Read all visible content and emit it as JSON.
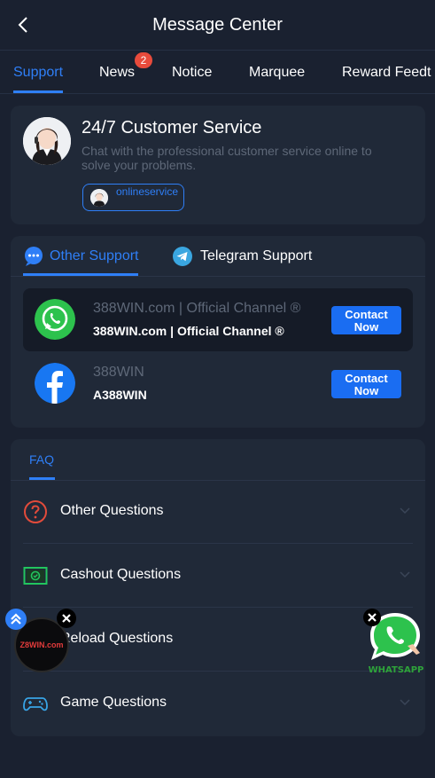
{
  "header": {
    "title": "Message Center"
  },
  "tabs": [
    {
      "label": "Support",
      "active": true
    },
    {
      "label": "News",
      "badge": "2"
    },
    {
      "label": "Notice"
    },
    {
      "label": "Marquee"
    },
    {
      "label": "Reward Feedt"
    }
  ],
  "customer_service": {
    "title": "24/7 Customer Service",
    "description": "Chat with the professional customer service online to solve your problems.",
    "online_label": "onlineservice"
  },
  "support": {
    "tabs": [
      {
        "label": "Other Support",
        "active": true
      },
      {
        "label": "Telegram Support"
      }
    ],
    "contacts": [
      {
        "title": "388WIN.com | Official Channel ®",
        "name": "388WIN.com | Official Channel ®",
        "button": "Contact Now",
        "icon": "whatsapp-icon"
      },
      {
        "title": "388WIN",
        "name": "A388WIN",
        "button": "Contact Now",
        "icon": "facebook-icon"
      }
    ]
  },
  "faq": {
    "tab_label": "FAQ",
    "items": [
      {
        "label": "Other Questions",
        "icon": "question-icon"
      },
      {
        "label": "Cashout Questions",
        "icon": "cashout-icon"
      },
      {
        "label": "Reload Questions",
        "icon": "reload-icon"
      },
      {
        "label": "Game Questions",
        "icon": "gamepad-icon"
      }
    ]
  },
  "floating": {
    "left_logo": "Z8WIN.com",
    "right_label": "WHATSAPP"
  },
  "colors": {
    "accent": "#2f7ff7",
    "background": "#1a2130",
    "card": "#202938",
    "badge": "#e84b3c",
    "button": "#1a6df2"
  }
}
